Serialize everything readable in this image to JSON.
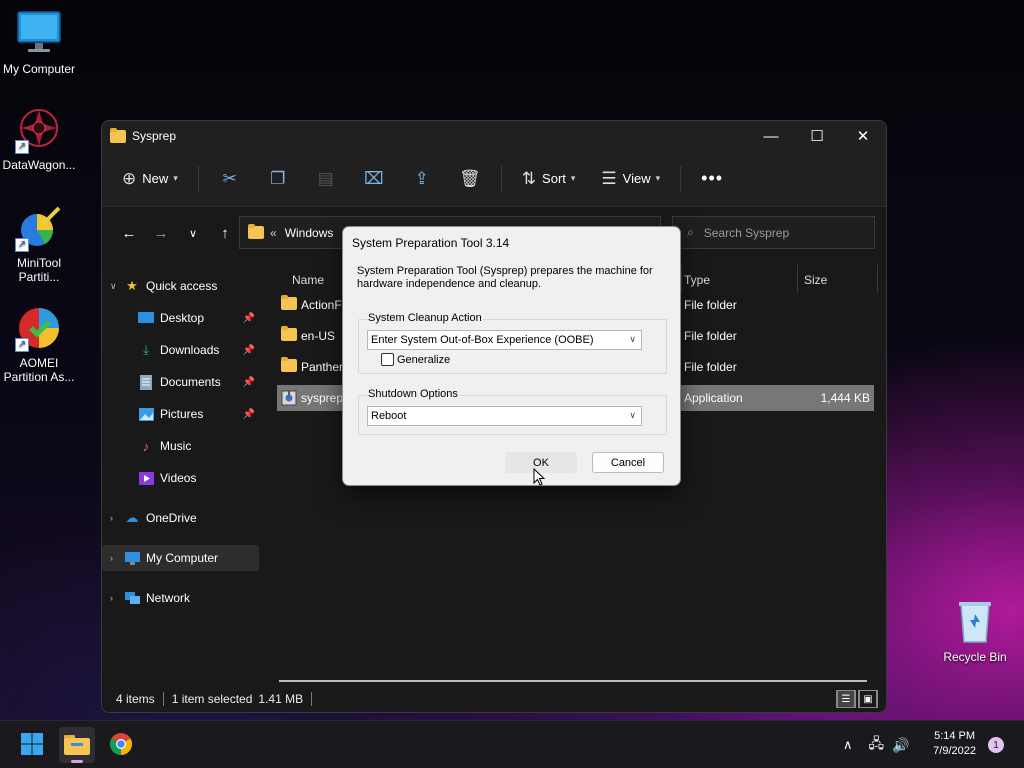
{
  "desktop": {
    "icons": [
      {
        "label": "My Computer",
        "icon": "monitor-icon"
      },
      {
        "label": "DataWagon...",
        "icon": "datawagon-icon"
      },
      {
        "label": "MiniTool Partiti...",
        "icon": "minitool-icon"
      },
      {
        "label": "AOMEI Partition As...",
        "icon": "aomei-icon"
      },
      {
        "label": "Recycle Bin",
        "icon": "recycle-bin-icon"
      }
    ]
  },
  "explorer": {
    "title": "Sysprep",
    "toolbar": {
      "new_label": "New",
      "sort_label": "Sort",
      "view_label": "View"
    },
    "address": {
      "prefix": "«",
      "path": "Windows"
    },
    "search": {
      "placeholder": "Search Sysprep"
    },
    "sidebar": {
      "quick_access": "Quick access",
      "items": [
        {
          "label": "Desktop",
          "pinned": true
        },
        {
          "label": "Downloads",
          "pinned": true
        },
        {
          "label": "Documents",
          "pinned": true
        },
        {
          "label": "Pictures",
          "pinned": true
        },
        {
          "label": "Music",
          "pinned": false
        },
        {
          "label": "Videos",
          "pinned": false
        }
      ],
      "onedrive": "OneDrive",
      "my_computer": "My Computer",
      "network": "Network"
    },
    "columns": {
      "name": "Name",
      "type": "Type",
      "size": "Size"
    },
    "files": [
      {
        "name": "ActionFi",
        "type": "File folder",
        "size": ""
      },
      {
        "name": "en-US",
        "type": "File folder",
        "size": ""
      },
      {
        "name": "Panther",
        "type": "File folder",
        "size": ""
      },
      {
        "name": "sysprep.",
        "type": "Application",
        "size": "1,444 KB"
      }
    ],
    "status": {
      "items": "4 items",
      "selected": "1 item selected",
      "size": "1.41 MB"
    }
  },
  "dialog": {
    "title": "System Preparation Tool 3.14",
    "description": "System Preparation Tool (Sysprep) prepares the machine for hardware independence and cleanup.",
    "cleanup_group": "System Cleanup Action",
    "cleanup_value": "Enter System Out-of-Box Experience (OOBE)",
    "generalize_label": "Generalize",
    "generalize_checked": false,
    "shutdown_group": "Shutdown Options",
    "shutdown_value": "Reboot",
    "ok_label": "OK",
    "cancel_label": "Cancel"
  },
  "taskbar": {
    "time": "5:14 PM",
    "date": "7/9/2022",
    "notifications": "1"
  },
  "colors": {
    "window_bg": "#191919",
    "selection": "#777777",
    "dialog_bg": "#f0f0f0",
    "accent_blue": "#7ab6e8",
    "folder_yellow": "#f5c453"
  }
}
